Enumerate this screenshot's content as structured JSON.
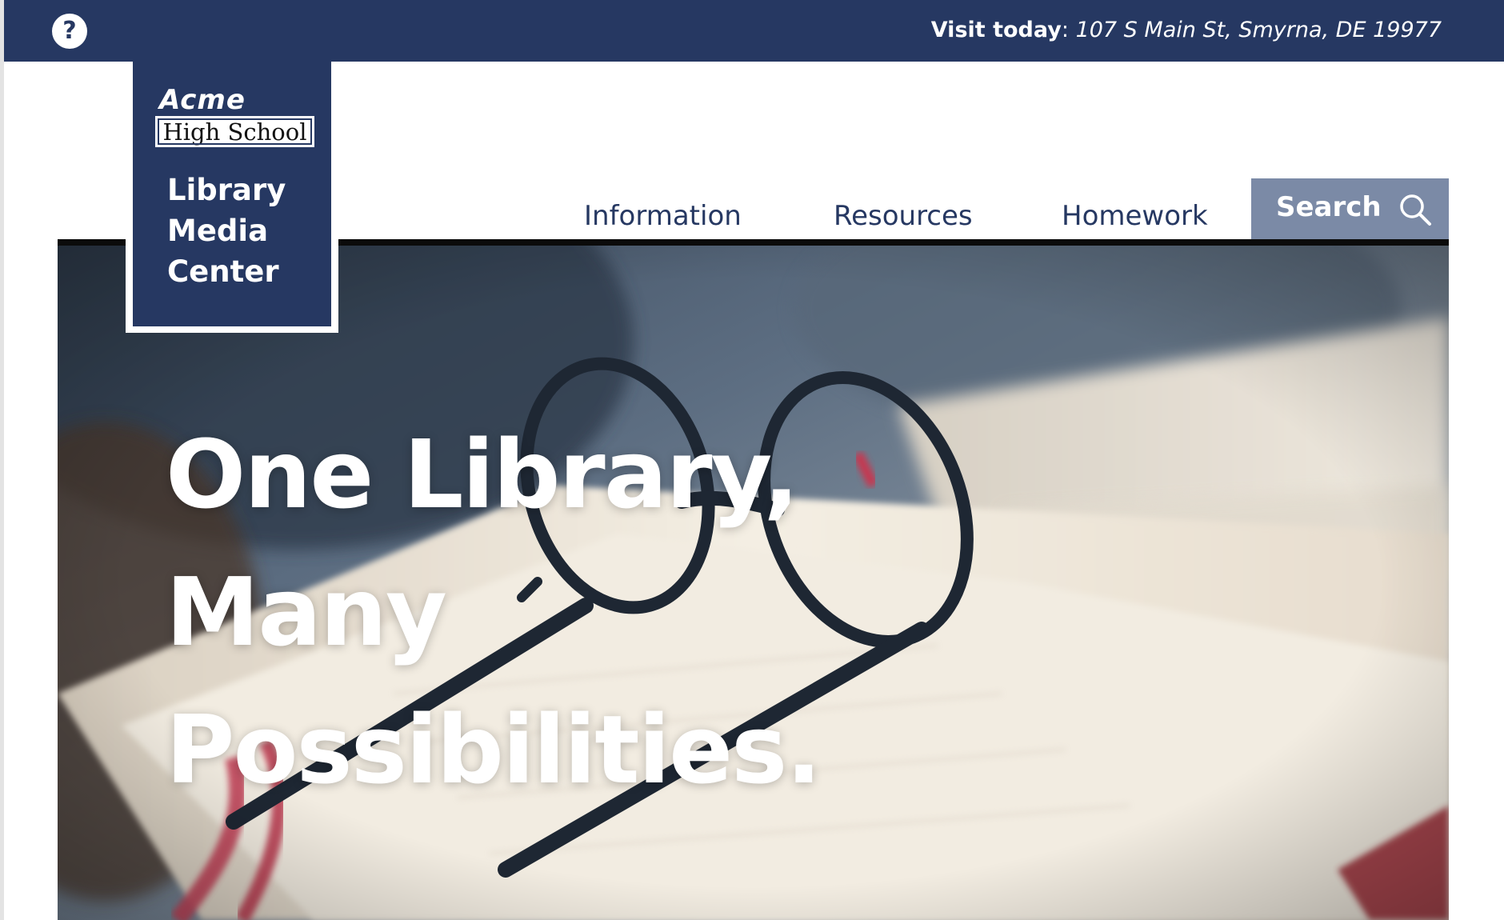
{
  "topbar": {
    "help_glyph": "?",
    "help_icon": "question-circle-icon",
    "visit_label": "Visit today",
    "visit_colon": ":",
    "visit_address": "107 S Main St, Smyrna, DE 19977"
  },
  "logo": {
    "acme": "Acme",
    "school": "High School",
    "lines": [
      "Library",
      "Media",
      "Center"
    ]
  },
  "nav": {
    "items": [
      {
        "label": "Information"
      },
      {
        "label": "Resources"
      },
      {
        "label": "Homework"
      }
    ],
    "search_label": "Search",
    "search_icon": "magnifier-icon"
  },
  "hero": {
    "lines": [
      "One Library,",
      "Many",
      "Possibilities."
    ],
    "image": "eyeglasses-on-open-book-photo"
  },
  "colors": {
    "brand_navy": "#263862",
    "search_bg": "#7b8aa6",
    "rule": "#0b0b0b",
    "white": "#ffffff"
  }
}
